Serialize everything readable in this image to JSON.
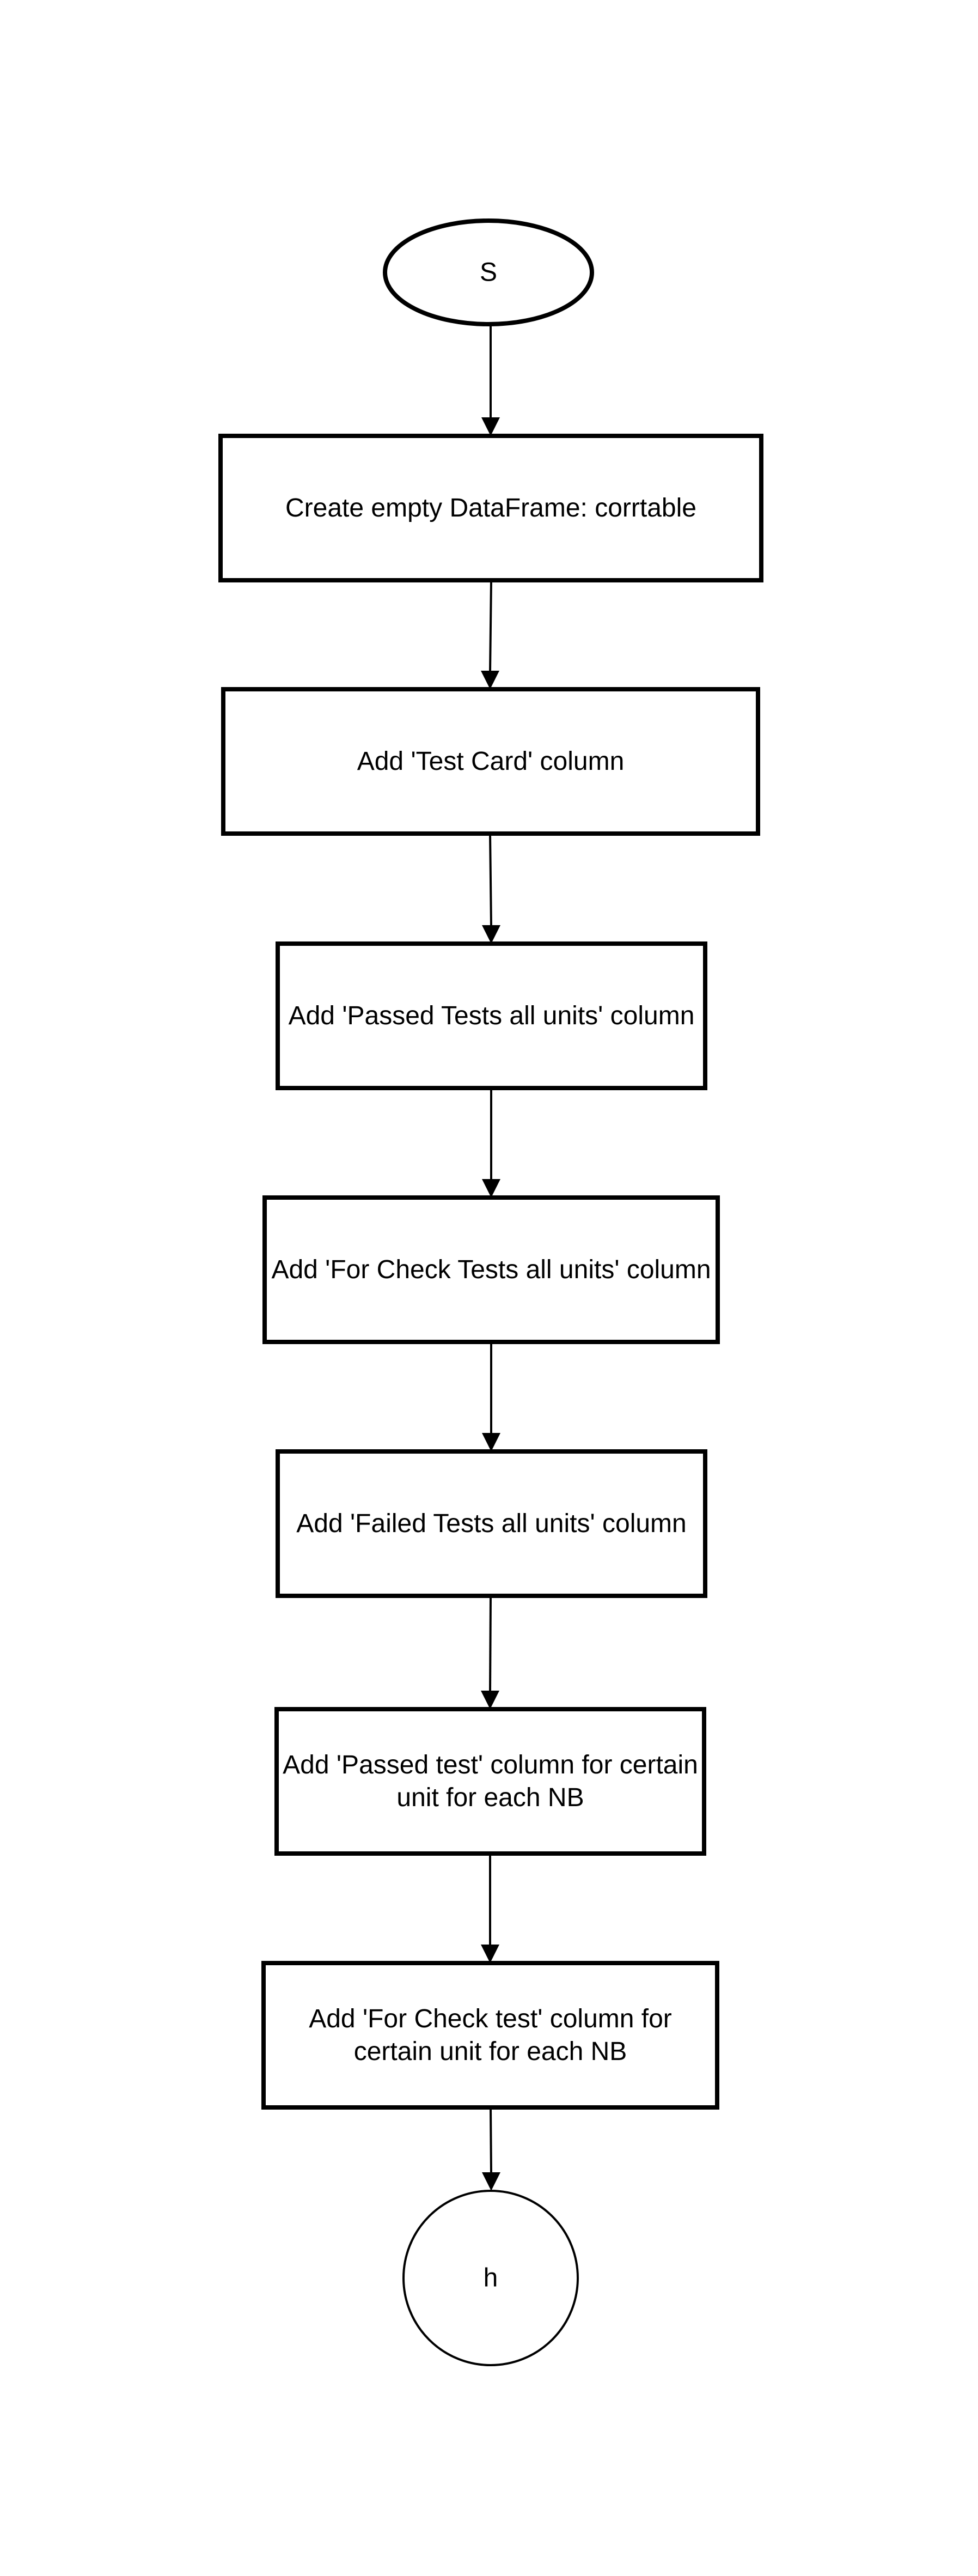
{
  "diagram": {
    "type": "flowchart",
    "nodes": [
      {
        "id": "start",
        "shape": "ellipse",
        "lines": [
          "S"
        ]
      },
      {
        "id": "create-df",
        "shape": "rect",
        "lines": [
          "Create empty DataFrame: corrtable"
        ]
      },
      {
        "id": "test-card",
        "shape": "rect",
        "lines": [
          "Add 'Test Card' column"
        ]
      },
      {
        "id": "passed-all",
        "shape": "rect",
        "lines": [
          "Add 'Passed Tests all units' column"
        ]
      },
      {
        "id": "check-all",
        "shape": "rect",
        "lines": [
          "Add 'For Check Tests all units' column"
        ]
      },
      {
        "id": "failed-all",
        "shape": "rect",
        "lines": [
          "Add 'Failed Tests all units' column"
        ]
      },
      {
        "id": "passed-unit",
        "shape": "rect",
        "lines": [
          "Add 'Passed test' column for certain",
          "unit for each NB"
        ]
      },
      {
        "id": "check-unit",
        "shape": "rect",
        "lines": [
          "Add 'For Check test' column for",
          "certain unit for each NB"
        ]
      },
      {
        "id": "end",
        "shape": "circle",
        "lines": [
          "h"
        ]
      }
    ],
    "edges": [
      {
        "from": "start",
        "to": "create-df"
      },
      {
        "from": "create-df",
        "to": "test-card"
      },
      {
        "from": "test-card",
        "to": "passed-all"
      },
      {
        "from": "passed-all",
        "to": "check-all"
      },
      {
        "from": "check-all",
        "to": "failed-all"
      },
      {
        "from": "failed-all",
        "to": "passed-unit"
      },
      {
        "from": "passed-unit",
        "to": "check-unit"
      },
      {
        "from": "check-unit",
        "to": "end"
      }
    ]
  }
}
